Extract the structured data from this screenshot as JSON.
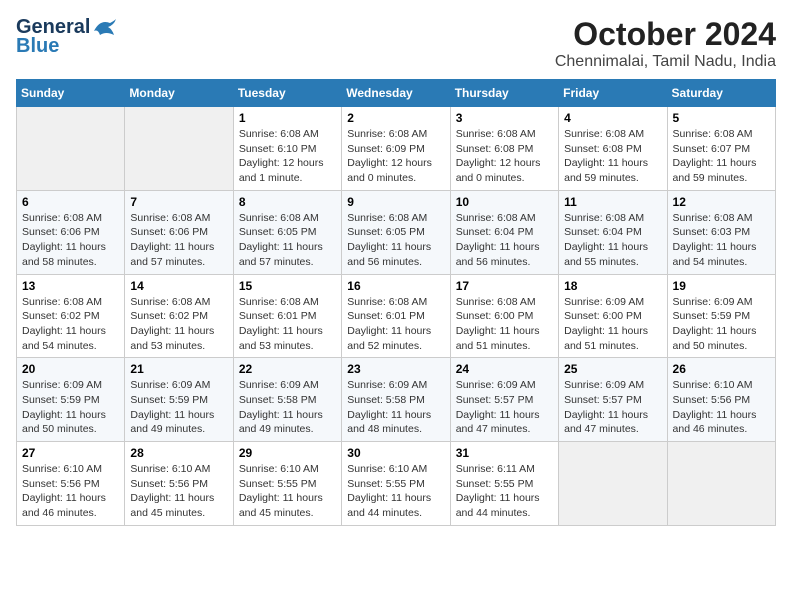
{
  "header": {
    "logo_general": "General",
    "logo_blue": "Blue",
    "title": "October 2024",
    "subtitle": "Chennimalai, Tamil Nadu, India"
  },
  "weekdays": [
    "Sunday",
    "Monday",
    "Tuesday",
    "Wednesday",
    "Thursday",
    "Friday",
    "Saturday"
  ],
  "weeks": [
    [
      {
        "day": "",
        "info": ""
      },
      {
        "day": "",
        "info": ""
      },
      {
        "day": "1",
        "info": "Sunrise: 6:08 AM\nSunset: 6:10 PM\nDaylight: 12 hours\nand 1 minute."
      },
      {
        "day": "2",
        "info": "Sunrise: 6:08 AM\nSunset: 6:09 PM\nDaylight: 12 hours\nand 0 minutes."
      },
      {
        "day": "3",
        "info": "Sunrise: 6:08 AM\nSunset: 6:08 PM\nDaylight: 12 hours\nand 0 minutes."
      },
      {
        "day": "4",
        "info": "Sunrise: 6:08 AM\nSunset: 6:08 PM\nDaylight: 11 hours\nand 59 minutes."
      },
      {
        "day": "5",
        "info": "Sunrise: 6:08 AM\nSunset: 6:07 PM\nDaylight: 11 hours\nand 59 minutes."
      }
    ],
    [
      {
        "day": "6",
        "info": "Sunrise: 6:08 AM\nSunset: 6:06 PM\nDaylight: 11 hours\nand 58 minutes."
      },
      {
        "day": "7",
        "info": "Sunrise: 6:08 AM\nSunset: 6:06 PM\nDaylight: 11 hours\nand 57 minutes."
      },
      {
        "day": "8",
        "info": "Sunrise: 6:08 AM\nSunset: 6:05 PM\nDaylight: 11 hours\nand 57 minutes."
      },
      {
        "day": "9",
        "info": "Sunrise: 6:08 AM\nSunset: 6:05 PM\nDaylight: 11 hours\nand 56 minutes."
      },
      {
        "day": "10",
        "info": "Sunrise: 6:08 AM\nSunset: 6:04 PM\nDaylight: 11 hours\nand 56 minutes."
      },
      {
        "day": "11",
        "info": "Sunrise: 6:08 AM\nSunset: 6:04 PM\nDaylight: 11 hours\nand 55 minutes."
      },
      {
        "day": "12",
        "info": "Sunrise: 6:08 AM\nSunset: 6:03 PM\nDaylight: 11 hours\nand 54 minutes."
      }
    ],
    [
      {
        "day": "13",
        "info": "Sunrise: 6:08 AM\nSunset: 6:02 PM\nDaylight: 11 hours\nand 54 minutes."
      },
      {
        "day": "14",
        "info": "Sunrise: 6:08 AM\nSunset: 6:02 PM\nDaylight: 11 hours\nand 53 minutes."
      },
      {
        "day": "15",
        "info": "Sunrise: 6:08 AM\nSunset: 6:01 PM\nDaylight: 11 hours\nand 53 minutes."
      },
      {
        "day": "16",
        "info": "Sunrise: 6:08 AM\nSunset: 6:01 PM\nDaylight: 11 hours\nand 52 minutes."
      },
      {
        "day": "17",
        "info": "Sunrise: 6:08 AM\nSunset: 6:00 PM\nDaylight: 11 hours\nand 51 minutes."
      },
      {
        "day": "18",
        "info": "Sunrise: 6:09 AM\nSunset: 6:00 PM\nDaylight: 11 hours\nand 51 minutes."
      },
      {
        "day": "19",
        "info": "Sunrise: 6:09 AM\nSunset: 5:59 PM\nDaylight: 11 hours\nand 50 minutes."
      }
    ],
    [
      {
        "day": "20",
        "info": "Sunrise: 6:09 AM\nSunset: 5:59 PM\nDaylight: 11 hours\nand 50 minutes."
      },
      {
        "day": "21",
        "info": "Sunrise: 6:09 AM\nSunset: 5:59 PM\nDaylight: 11 hours\nand 49 minutes."
      },
      {
        "day": "22",
        "info": "Sunrise: 6:09 AM\nSunset: 5:58 PM\nDaylight: 11 hours\nand 49 minutes."
      },
      {
        "day": "23",
        "info": "Sunrise: 6:09 AM\nSunset: 5:58 PM\nDaylight: 11 hours\nand 48 minutes."
      },
      {
        "day": "24",
        "info": "Sunrise: 6:09 AM\nSunset: 5:57 PM\nDaylight: 11 hours\nand 47 minutes."
      },
      {
        "day": "25",
        "info": "Sunrise: 6:09 AM\nSunset: 5:57 PM\nDaylight: 11 hours\nand 47 minutes."
      },
      {
        "day": "26",
        "info": "Sunrise: 6:10 AM\nSunset: 5:56 PM\nDaylight: 11 hours\nand 46 minutes."
      }
    ],
    [
      {
        "day": "27",
        "info": "Sunrise: 6:10 AM\nSunset: 5:56 PM\nDaylight: 11 hours\nand 46 minutes."
      },
      {
        "day": "28",
        "info": "Sunrise: 6:10 AM\nSunset: 5:56 PM\nDaylight: 11 hours\nand 45 minutes."
      },
      {
        "day": "29",
        "info": "Sunrise: 6:10 AM\nSunset: 5:55 PM\nDaylight: 11 hours\nand 45 minutes."
      },
      {
        "day": "30",
        "info": "Sunrise: 6:10 AM\nSunset: 5:55 PM\nDaylight: 11 hours\nand 44 minutes."
      },
      {
        "day": "31",
        "info": "Sunrise: 6:11 AM\nSunset: 5:55 PM\nDaylight: 11 hours\nand 44 minutes."
      },
      {
        "day": "",
        "info": ""
      },
      {
        "day": "",
        "info": ""
      }
    ]
  ]
}
